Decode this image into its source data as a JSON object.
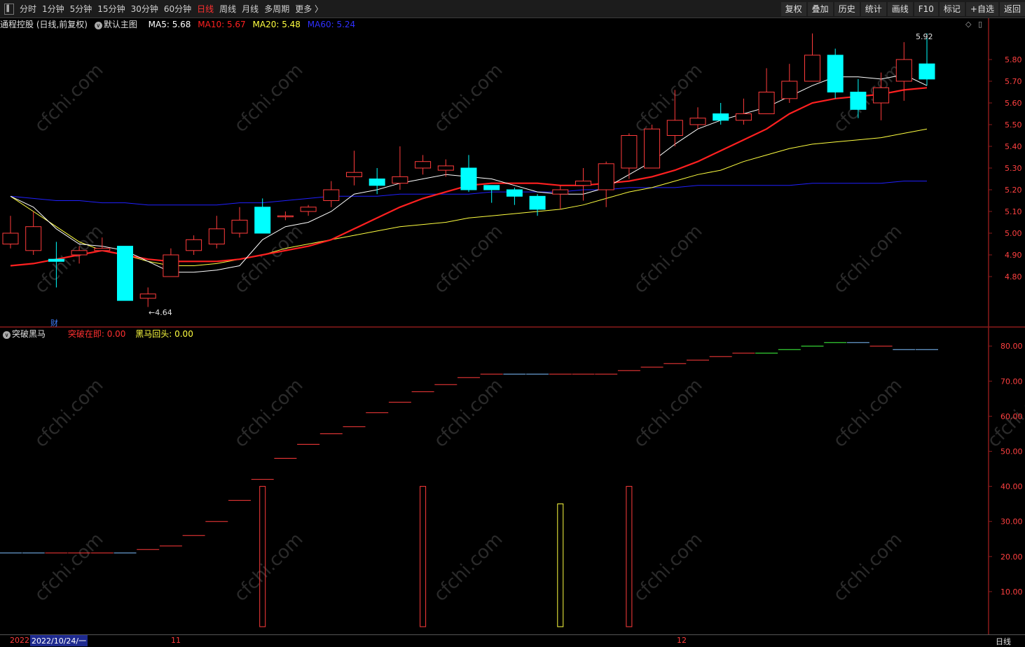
{
  "toolbar": {
    "periods": [
      "分时",
      "1分钟",
      "5分钟",
      "15分钟",
      "30分钟",
      "60分钟",
      "日线",
      "周线",
      "月线",
      "多周期",
      "更多 〉"
    ],
    "active_period": "日线",
    "right_buttons": [
      "复权",
      "叠加",
      "历史",
      "统计",
      "画线",
      "F10",
      "标记",
      "+自选",
      "返回"
    ]
  },
  "main_info": {
    "title": "通程控股 (日线,前复权)",
    "template": "默认主图",
    "ma5": "MA5: 5.68",
    "ma10": "MA10: 5.67",
    "ma20": "MA20: 5.48",
    "ma60": "MA60: 5.24"
  },
  "sub_info": {
    "title": "突破黑马",
    "breakthrough": "突破在即: 0.00",
    "dark_horse": "黑马回头: 0.00"
  },
  "price_axis": [
    "5.80",
    "5.70",
    "5.60",
    "5.50",
    "5.40",
    "5.30",
    "5.20",
    "5.10",
    "5.00",
    "4.90",
    "4.80"
  ],
  "sub_axis": [
    "80.00",
    "70.00",
    "60.00",
    "50.00",
    "40.00",
    "30.00",
    "20.00",
    "10.00"
  ],
  "annotations": {
    "high": "5.92",
    "low": "4.64",
    "fin_marker": "财"
  },
  "bottom": {
    "date_left": "2022",
    "date_cursor": "2022/10/24/一",
    "month_nov": "11",
    "month_dec": "12",
    "period_label": "日线"
  },
  "watermark": "cfchi.com",
  "colors": {
    "up": "#ff3b3b",
    "down": "#00ffff",
    "ma5": "#ffffff",
    "ma10": "#ff2020",
    "ma20": "#ffff40",
    "ma60": "#2020ff"
  },
  "chart_data": [
    {
      "type": "candlestick",
      "title": "通程控股 (日线,前复权)",
      "x": [
        "10/24",
        "",
        "",
        "",
        "",
        "",
        "",
        "",
        "",
        "",
        "",
        "",
        "",
        "",
        "",
        "",
        "",
        "",
        "",
        "",
        "",
        "",
        "",
        "",
        "",
        "",
        "",
        "",
        "",
        "",
        "",
        "",
        "",
        "",
        "",
        "",
        "",
        "",
        "",
        "",
        ""
      ],
      "open": [
        4.95,
        4.92,
        4.88,
        4.9,
        4.92,
        4.94,
        4.7,
        4.8,
        4.92,
        4.95,
        5.0,
        5.12,
        5.08,
        5.1,
        5.15,
        5.26,
        5.25,
        5.23,
        5.3,
        5.29,
        5.3,
        5.22,
        5.2,
        5.17,
        5.18,
        5.22,
        5.2,
        5.3,
        5.3,
        5.45,
        5.5,
        5.55,
        5.52,
        5.55,
        5.62,
        5.7,
        5.82,
        5.65,
        5.6,
        5.7,
        5.78
      ],
      "close": [
        5.0,
        5.03,
        4.87,
        4.92,
        4.93,
        4.69,
        4.72,
        4.9,
        4.97,
        5.02,
        5.06,
        5.0,
        5.08,
        5.12,
        5.2,
        5.28,
        5.22,
        5.26,
        5.33,
        5.31,
        5.2,
        5.2,
        5.17,
        5.11,
        5.2,
        5.24,
        5.32,
        5.45,
        5.48,
        5.52,
        5.53,
        5.52,
        5.55,
        5.65,
        5.7,
        5.82,
        5.65,
        5.57,
        5.67,
        5.8,
        5.71
      ],
      "high": [
        5.08,
        5.1,
        4.96,
        4.94,
        4.98,
        4.94,
        4.75,
        4.93,
        4.99,
        5.08,
        5.12,
        5.16,
        5.1,
        5.13,
        5.24,
        5.38,
        5.3,
        5.4,
        5.36,
        5.34,
        5.36,
        5.21,
        5.21,
        5.18,
        5.22,
        5.3,
        5.33,
        5.46,
        5.5,
        5.66,
        5.58,
        5.6,
        5.62,
        5.76,
        5.78,
        5.92,
        5.85,
        5.71,
        5.74,
        5.88,
        5.92
      ],
      "low": [
        4.93,
        4.9,
        4.75,
        4.86,
        4.92,
        4.69,
        4.66,
        4.8,
        4.9,
        4.93,
        4.98,
        5.0,
        5.06,
        5.08,
        5.12,
        5.22,
        5.18,
        5.2,
        5.27,
        5.26,
        5.19,
        5.14,
        5.13,
        5.08,
        5.11,
        5.15,
        5.12,
        5.25,
        5.3,
        5.4,
        5.48,
        5.5,
        5.5,
        5.55,
        5.6,
        5.7,
        5.62,
        5.53,
        5.52,
        5.61,
        5.68
      ],
      "ma5": [
        5.17,
        5.12,
        5.02,
        4.95,
        4.94,
        4.92,
        4.87,
        4.82,
        4.82,
        4.83,
        4.85,
        4.97,
        5.03,
        5.05,
        5.1,
        5.18,
        5.2,
        5.23,
        5.25,
        5.27,
        5.26,
        5.25,
        5.22,
        5.19,
        5.18,
        5.18,
        5.21,
        5.27,
        5.33,
        5.41,
        5.48,
        5.52,
        5.55,
        5.58,
        5.63,
        5.68,
        5.72,
        5.72,
        5.71,
        5.73,
        5.68
      ],
      "ma10": [
        4.85,
        4.86,
        4.88,
        4.9,
        4.92,
        4.9,
        4.88,
        4.87,
        4.87,
        4.87,
        4.88,
        4.9,
        4.92,
        4.94,
        4.97,
        5.02,
        5.07,
        5.12,
        5.16,
        5.19,
        5.22,
        5.23,
        5.23,
        5.23,
        5.22,
        5.22,
        5.23,
        5.24,
        5.26,
        5.29,
        5.33,
        5.38,
        5.43,
        5.48,
        5.55,
        5.6,
        5.62,
        5.63,
        5.64,
        5.66,
        5.67
      ],
      "ma20": [
        5.17,
        5.1,
        5.03,
        4.96,
        4.92,
        4.9,
        4.87,
        4.85,
        4.85,
        4.86,
        4.88,
        4.9,
        4.93,
        4.95,
        4.97,
        4.99,
        5.01,
        5.03,
        5.04,
        5.05,
        5.07,
        5.08,
        5.09,
        5.1,
        5.11,
        5.13,
        5.16,
        5.19,
        5.21,
        5.24,
        5.27,
        5.29,
        5.33,
        5.36,
        5.39,
        5.41,
        5.42,
        5.43,
        5.44,
        5.46,
        5.48
      ],
      "ma60": [
        5.17,
        5.16,
        5.15,
        5.15,
        5.14,
        5.14,
        5.13,
        5.13,
        5.13,
        5.13,
        5.14,
        5.14,
        5.15,
        5.16,
        5.17,
        5.17,
        5.17,
        5.18,
        5.18,
        5.18,
        5.18,
        5.19,
        5.19,
        5.19,
        5.19,
        5.2,
        5.2,
        5.21,
        5.21,
        5.21,
        5.22,
        5.22,
        5.22,
        5.22,
        5.22,
        5.23,
        5.23,
        5.23,
        5.23,
        5.24,
        5.24
      ],
      "ylim": [
        4.64,
        5.95
      ],
      "y_ticks": [
        4.8,
        4.9,
        5.0,
        5.1,
        5.2,
        5.3,
        5.4,
        5.5,
        5.6,
        5.7,
        5.8
      ]
    },
    {
      "type": "bar",
      "title": "突破黑马",
      "series": [
        {
          "name": "突破在即",
          "values": [
            0,
            0,
            0,
            0,
            0,
            0,
            0,
            0,
            0,
            0,
            0,
            40,
            0,
            0,
            0,
            0,
            0,
            0,
            40,
            0,
            0,
            0,
            0,
            0,
            0,
            0,
            0,
            40,
            0,
            0,
            0,
            0,
            0,
            0,
            0,
            0,
            0,
            0,
            0,
            0,
            0
          ]
        },
        {
          "name": "黑马回头",
          "values": [
            0,
            0,
            0,
            0,
            0,
            0,
            0,
            0,
            0,
            0,
            0,
            0,
            0,
            0,
            0,
            0,
            0,
            0,
            0,
            0,
            0,
            0,
            0,
            0,
            35,
            0,
            0,
            0,
            0,
            0,
            0,
            0,
            0,
            0,
            0,
            0,
            0,
            0,
            0,
            0,
            0
          ]
        }
      ],
      "level": [
        21,
        21,
        21,
        21,
        21,
        21,
        22,
        23,
        26,
        30,
        36,
        42,
        48,
        52,
        55,
        57,
        61,
        64,
        67,
        69,
        71,
        72,
        72,
        72,
        72,
        72,
        72,
        73,
        74,
        75,
        76,
        77,
        78,
        78,
        79,
        80,
        81,
        81,
        80,
        79,
        79
      ],
      "level_colors": [
        "#7fbfff",
        "#7fbfff",
        "#ff3b3b",
        "#ff3b3b",
        "#ff3b3b",
        "#7fbfff",
        "#ff3b3b",
        "#ff3b3b",
        "#ff3b3b",
        "#ff3b3b",
        "#ff3b3b",
        "#ff3b3b",
        "#ff3b3b",
        "#ff3b3b",
        "#ff3b3b",
        "#ff3b3b",
        "#ff3b3b",
        "#ff3b3b",
        "#ff3b3b",
        "#ff3b3b",
        "#ff3b3b",
        "#ff3b3b",
        "#7fbfff",
        "#7fbfff",
        "#ff3b3b",
        "#ff3b3b",
        "#ff3b3b",
        "#ff3b3b",
        "#ff3b3b",
        "#ff3b3b",
        "#ff3b3b",
        "#ff3b3b",
        "#ff3b3b",
        "#40ff40",
        "#40ff40",
        "#40ff40",
        "#40ff40",
        "#7fbfff",
        "#ff3b3b",
        "#7fbfff",
        "#7fbfff"
      ],
      "ylim": [
        0,
        85
      ],
      "y_ticks": [
        10,
        20,
        30,
        40,
        50,
        60,
        70,
        80
      ]
    }
  ]
}
